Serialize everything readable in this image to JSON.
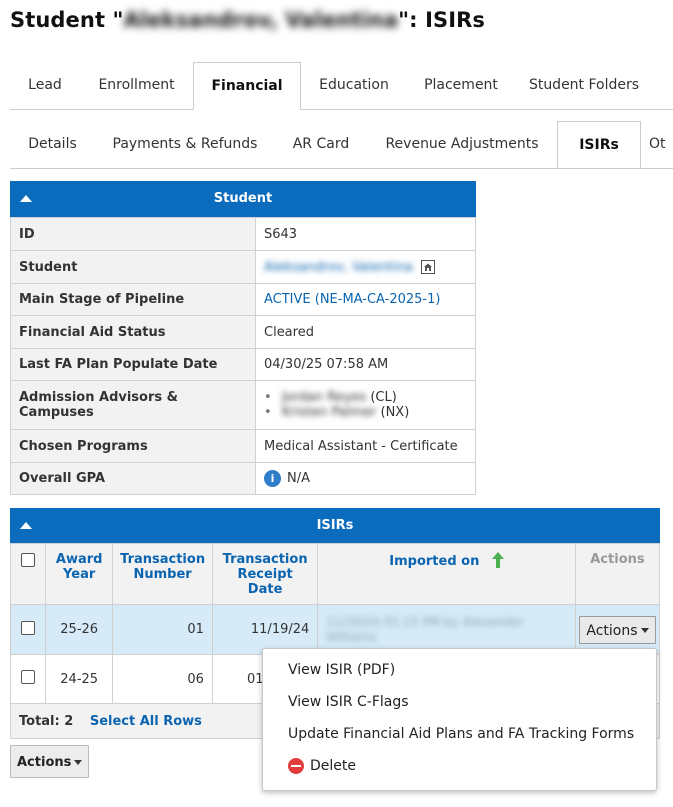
{
  "page": {
    "title_prefix": "Student \"",
    "title_name": "Aleksandrov, Valentina",
    "title_suffix": "\": ISIRs"
  },
  "tabs_primary": [
    {
      "label": "Lead"
    },
    {
      "label": "Enrollment"
    },
    {
      "label": "Financial",
      "active": true
    },
    {
      "label": "Education"
    },
    {
      "label": "Placement"
    },
    {
      "label": "Student Folders"
    }
  ],
  "tabs_secondary": [
    {
      "label": "Details"
    },
    {
      "label": "Payments & Refunds"
    },
    {
      "label": "AR Card"
    },
    {
      "label": "Revenue Adjustments"
    },
    {
      "label": "ISIRs",
      "active": true
    },
    {
      "label": "Ot"
    }
  ],
  "student_panel": {
    "heading": "Student",
    "rows": {
      "id": {
        "label": "ID",
        "value": "S643"
      },
      "student": {
        "label": "Student",
        "value": "Aleksandrov, Valentina"
      },
      "stage": {
        "label": "Main Stage of Pipeline",
        "value": "ACTIVE (NE-MA-CA-2025-1)"
      },
      "fa_status": {
        "label": "Financial Aid Status",
        "value": "Cleared"
      },
      "last_fa": {
        "label": "Last FA Plan Populate Date",
        "value": "04/30/25 07:58 AM"
      },
      "advisors": {
        "label": "Admission Advisors & Campuses",
        "items": [
          {
            "name": "Jordan Reyes",
            "campus": "(CL)"
          },
          {
            "name": "Kristen Palmer",
            "campus": "(NX)"
          }
        ]
      },
      "programs": {
        "label": "Chosen Programs",
        "value": "Medical Assistant - Certificate"
      },
      "gpa": {
        "label": "Overall GPA",
        "value": "N/A"
      }
    }
  },
  "isirs_panel": {
    "heading": "ISIRs",
    "columns": {
      "award_year": "Award Year",
      "transaction_number": "Transaction Number",
      "receipt_date": "Transaction Receipt Date",
      "imported_on": "Imported on",
      "actions": "Actions"
    },
    "rows": [
      {
        "award_year": "25-26",
        "transaction_number": "01",
        "receipt_date": "11/19/24",
        "imported_on": "11/20/24 01:15 PM by Alexander Williams",
        "actions_label": "Actions"
      },
      {
        "award_year": "24-25",
        "transaction_number": "06",
        "receipt_date": "01/",
        "imported_on": ""
      }
    ],
    "total_label": "Total: 2",
    "select_all_label": "Select All Rows"
  },
  "bottom_actions_label": "Actions",
  "dropdown_menu": {
    "items": [
      {
        "label": "View ISIR (PDF)"
      },
      {
        "label": "View ISIR C-Flags"
      },
      {
        "label": "Update Financial Aid Plans and FA Tracking Forms"
      },
      {
        "label": "Delete",
        "icon": "delete-icon"
      }
    ]
  },
  "colors": {
    "header_blue": "#0b6bbd",
    "link_blue": "#0b64b0",
    "selected_row": "#d6eaf8",
    "sort_arrow_green": "#4caf50",
    "delete_red": "#e03c3c"
  }
}
